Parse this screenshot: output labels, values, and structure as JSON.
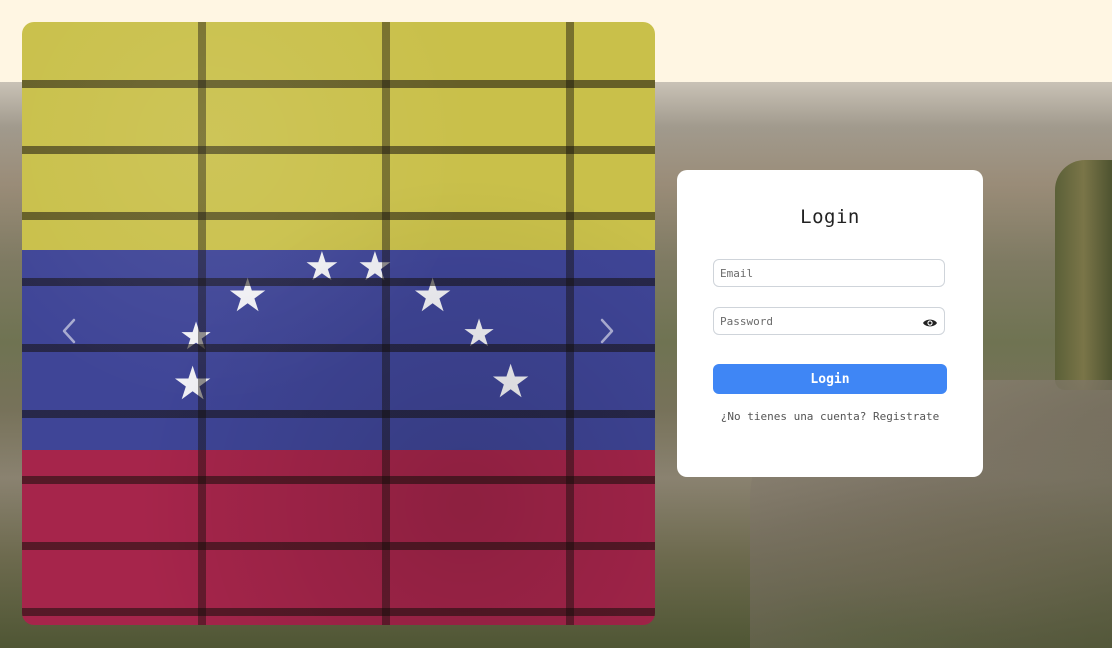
{
  "login": {
    "title": "Login",
    "email_placeholder": "Email",
    "password_placeholder": "Password",
    "submit_label": "Login",
    "register_prompt": "¿No tienes una cuenta?",
    "register_link": "Registrate"
  },
  "carousel": {
    "image": "venezuela-flag-brick-wall",
    "prev_icon": "chevron-left-icon",
    "next_icon": "chevron-right-icon"
  },
  "colors": {
    "primary_button": "#3f86f5",
    "flag_yellow": "#c9c04a",
    "flag_blue": "#3f4597",
    "flag_red": "#a6254b"
  }
}
